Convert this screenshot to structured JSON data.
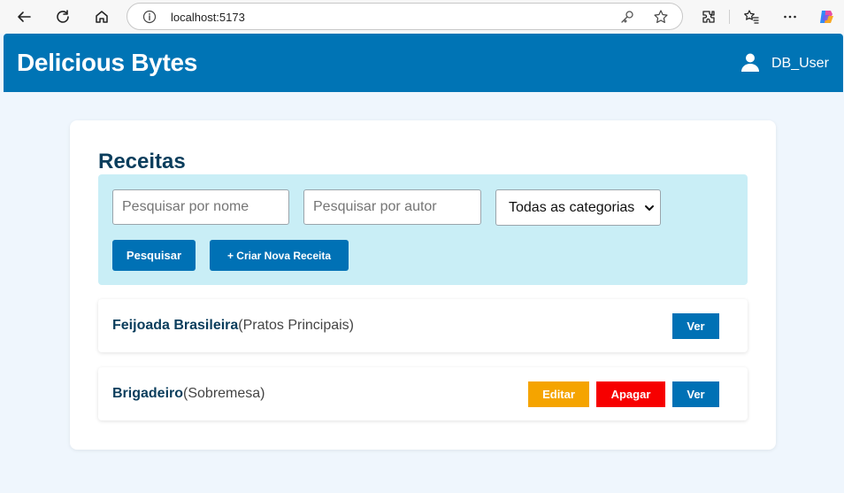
{
  "browser": {
    "url": "localhost:5173",
    "icons": [
      "back-icon",
      "refresh-icon",
      "home-icon",
      "info-icon",
      "key-icon",
      "star-icon",
      "extensions-icon",
      "favorites-icon",
      "more-icon",
      "copilot-icon"
    ]
  },
  "header": {
    "brand": "Delicious Bytes",
    "user_name": "DB_User"
  },
  "main": {
    "title": "Receitas",
    "filters": {
      "name_placeholder": "Pesquisar por nome",
      "author_placeholder": "Pesquisar por autor",
      "category_selected": "Todas as categorias",
      "search_label": "Pesquisar",
      "create_label": "+ Criar Nova Receita"
    },
    "recipes": [
      {
        "name": "Feijoada Brasileira",
        "category": "(Pratos Principais)",
        "view_label": "Ver"
      },
      {
        "name": "Brigadeiro",
        "category": "(Sobremesa)",
        "edit_label": "Editar",
        "delete_label": "Apagar",
        "view_label": "Ver"
      }
    ]
  },
  "colors": {
    "primary": "#0074b5",
    "filter_bg": "#c9eef6",
    "page_bg": "#eff6fd",
    "edit": "#f5a400",
    "delete": "#f70000",
    "title": "#0a3d5c"
  }
}
